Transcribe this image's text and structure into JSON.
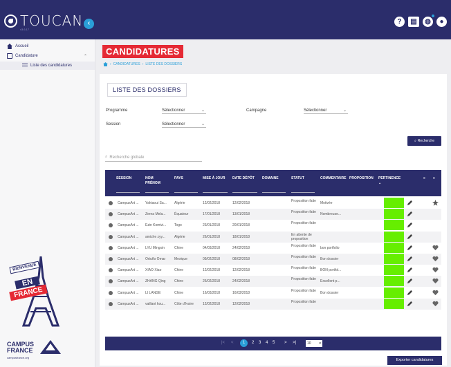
{
  "app": {
    "logo_text": "TOUCAN",
    "version": "v3.6.17"
  },
  "header_icons": [
    "help-icon",
    "id-card-icon",
    "language-icon",
    "user-icon"
  ],
  "sidebar": {
    "items": [
      {
        "label": "Accueil",
        "icon": "home-icon"
      },
      {
        "label": "Candidature",
        "icon": "candidature-icon"
      },
      {
        "label": "Liste des candidatures",
        "icon": "list-icon"
      }
    ]
  },
  "promo": {
    "bienvenue": "BIENVENUE",
    "en": "EN",
    "france": "FRANCE",
    "campus_line1": "CAMPUS",
    "campus_line2": "FRANCE",
    "campus_url": "campusfrance.org"
  },
  "page": {
    "title": "CANDIDATURES",
    "breadcrumb": [
      "CANDIDATURES",
      "LISTE DES DOSSIERS"
    ],
    "card_title": "LISTE DES DOSSIERS"
  },
  "filters": {
    "programme_label": "Programme",
    "programme_value": "Sélectionner",
    "campagne_label": "Campagne",
    "campagne_value": "Sélectionner",
    "session_label": "Session",
    "session_value": "Sélectionner",
    "search_button": "Recherche",
    "global_search_placeholder": "Recherche globale"
  },
  "table": {
    "columns": {
      "session": "SESSION",
      "nom": "NOM",
      "prenom": "PRÉNOM",
      "pays": "PAYS",
      "maj": "MISE À JOUR",
      "depot": "DATE DÉPÔT",
      "domaine": "DOMAINE",
      "statut": "STATUT",
      "commentaire": "COMMENTAIRE",
      "proposition": "PROPOSITION",
      "pertinence": "PERTINENCE"
    },
    "rows": [
      {
        "session": "CampusArt ...",
        "nom": "Yahiaoui Sa...",
        "pays": "Algérie",
        "maj": "12/02/2018",
        "depot": "12/02/2018",
        "statut": "Proposition faite",
        "commentaire": "Motivée",
        "fav": "star"
      },
      {
        "session": "CampusArt ...",
        "nom": "Zerna Mela...",
        "pays": "Équateur",
        "maj": "17/01/2018",
        "depot": "13/01/2018",
        "statut": "Proposition faite",
        "commentaire": "Nombreuse...",
        "fav": ""
      },
      {
        "session": "CampusArt ...",
        "nom": "Ezin Komivi...",
        "pays": "Togo",
        "maj": "23/01/2018",
        "depot": "20/01/2018",
        "statut": "Proposition faite",
        "commentaire": "",
        "fav": ""
      },
      {
        "session": "CampusArt ...",
        "nom": "amiche zyy...",
        "pays": "Algérie",
        "maj": "26/01/2018",
        "depot": "18/01/2018",
        "statut": "En attente de proposition",
        "commentaire": "",
        "fav": ""
      },
      {
        "session": "CampusArt ...",
        "nom": "LYU Mingxin",
        "pays": "Chine",
        "maj": "04/03/2018",
        "depot": "24/02/2018",
        "statut": "Proposition faite",
        "commentaire": "bon portfolio",
        "fav": "heart"
      },
      {
        "session": "CampusArt ...",
        "nom": "Ortuño Omar",
        "pays": "Mexique",
        "maj": "09/02/2018",
        "depot": "08/02/2018",
        "statut": "Proposition faite",
        "commentaire": "Bon dossier",
        "fav": "heart"
      },
      {
        "session": "CampusArt ...",
        "nom": "XIAO Xiao",
        "pays": "Chine",
        "maj": "12/02/2018",
        "depot": "12/02/2018",
        "statut": "Proposition faite",
        "commentaire": "BON portfol...",
        "fav": "heart"
      },
      {
        "session": "CampusArt ...",
        "nom": "ZHANG Qing",
        "pays": "Chine",
        "maj": "26/02/2018",
        "depot": "24/02/2018",
        "statut": "Proposition faite",
        "commentaire": "Excellent p...",
        "fav": "heart"
      },
      {
        "session": "CampusArt ...",
        "nom": "LI LANGE",
        "pays": "Chine",
        "maj": "16/03/2018",
        "depot": "16/03/2018",
        "statut": "Proposition faite",
        "commentaire": "Bon dossier",
        "fav": "heart"
      },
      {
        "session": "CampusArt ...",
        "nom": "vaillant kou...",
        "pays": "Côte d'Ivoire",
        "maj": "12/02/2018",
        "depot": "12/02/2018",
        "statut": "Proposition faite",
        "commentaire": "",
        "fav": "heart"
      }
    ]
  },
  "pager": {
    "first": "|<",
    "prev": "<",
    "pages": [
      "1",
      "2",
      "3",
      "4",
      "5"
    ],
    "next": ">",
    "last": ">|",
    "page_size": "10"
  },
  "export_button": "Exporter candidatures",
  "colors": {
    "navy": "#2b2d6b",
    "red": "#e52a35",
    "blue": "#2a9fd8",
    "green": "#66ee00"
  }
}
